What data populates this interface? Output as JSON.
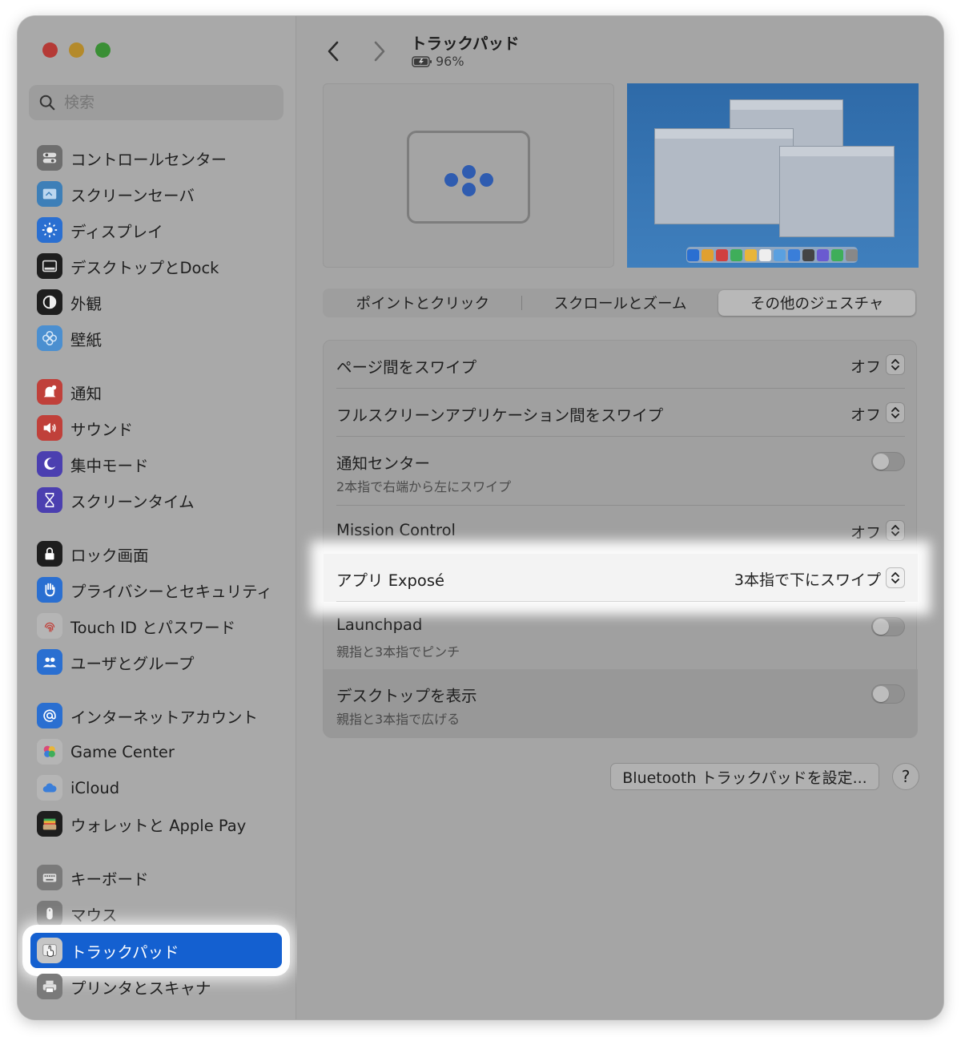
{
  "window": {
    "title": "トラックパッド",
    "battery": "96%"
  },
  "search": {
    "placeholder": "検索"
  },
  "sidebar": {
    "items": [
      {
        "label": "コントロールセンター",
        "icon": "control-center-icon",
        "color": "#6e6e6e"
      },
      {
        "label": "スクリーンセーバ",
        "icon": "screensaver-icon",
        "color": "#3d7fb8"
      },
      {
        "label": "ディスプレイ",
        "icon": "display-icon",
        "color": "#2a6fd1"
      },
      {
        "label": "デスクトップとDock",
        "icon": "dock-icon",
        "color": "#1e1e1e"
      },
      {
        "label": "外観",
        "icon": "appearance-icon",
        "color": "#1e1e1e"
      },
      {
        "label": "壁紙",
        "icon": "wallpaper-icon",
        "color": "#4b8fd0"
      },
      {
        "label": "通知",
        "icon": "notifications-icon",
        "color": "#c0403a"
      },
      {
        "label": "サウンド",
        "icon": "sound-icon",
        "color": "#c0403a"
      },
      {
        "label": "集中モード",
        "icon": "focus-icon",
        "color": "#4b3fb0"
      },
      {
        "label": "スクリーンタイム",
        "icon": "screen-time-icon",
        "color": "#4b3fb0"
      },
      {
        "label": "ロック画面",
        "icon": "lock-screen-icon",
        "color": "#1e1e1e"
      },
      {
        "label": "プライバシーとセキュリティ",
        "icon": "privacy-hand-icon",
        "color": "#2a6fd1"
      },
      {
        "label": "Touch ID とパスワード",
        "icon": "fingerprint-icon",
        "color": "#b5b5b5"
      },
      {
        "label": "ユーザとグループ",
        "icon": "users-icon",
        "color": "#2a6fd1"
      },
      {
        "label": "インターネットアカウント",
        "icon": "at-sign-icon",
        "color": "#2a6fd1"
      },
      {
        "label": "Game Center",
        "icon": "game-center-icon",
        "color": "#b5b5b5"
      },
      {
        "label": "iCloud",
        "icon": "icloud-icon",
        "color": "#b5b5b5"
      },
      {
        "label": "ウォレットと Apple Pay",
        "icon": "wallet-icon",
        "color": "#1e1e1e"
      },
      {
        "label": "キーボード",
        "icon": "keyboard-icon",
        "color": "#7a7a7a"
      },
      {
        "label": "マウス",
        "icon": "mouse-icon",
        "color": "#7a7a7a"
      },
      {
        "label": "トラックパッド",
        "icon": "trackpad-icon",
        "color": "#7a7a7a"
      },
      {
        "label": "プリンタとスキャナ",
        "icon": "printer-icon",
        "color": "#7a7a7a"
      }
    ]
  },
  "tabs": [
    {
      "label": "ポイントとクリック"
    },
    {
      "label": "スクロールとズーム"
    },
    {
      "label": "その他のジェスチャ"
    }
  ],
  "settings": [
    {
      "label": "ページ間をスワイプ",
      "value": "オフ"
    },
    {
      "label": "フルスクリーンアプリケーション間をスワイプ",
      "value": "オフ"
    },
    {
      "label": "通知センター",
      "sub": "2本指で右端から左にスワイプ",
      "on": false
    },
    {
      "label": "Mission Control",
      "value": "オフ"
    },
    {
      "label": "アプリ Exposé",
      "value": "3本指で下にスワイプ"
    },
    {
      "label": "Launchpad",
      "sub": "親指と3本指でピンチ",
      "on": false
    },
    {
      "label": "デスクトップを表示",
      "sub": "親指と3本指で広げる",
      "on": false
    }
  ],
  "buttons": {
    "bluetooth": "Bluetooth トラックパッドを設定...",
    "help": "?"
  }
}
